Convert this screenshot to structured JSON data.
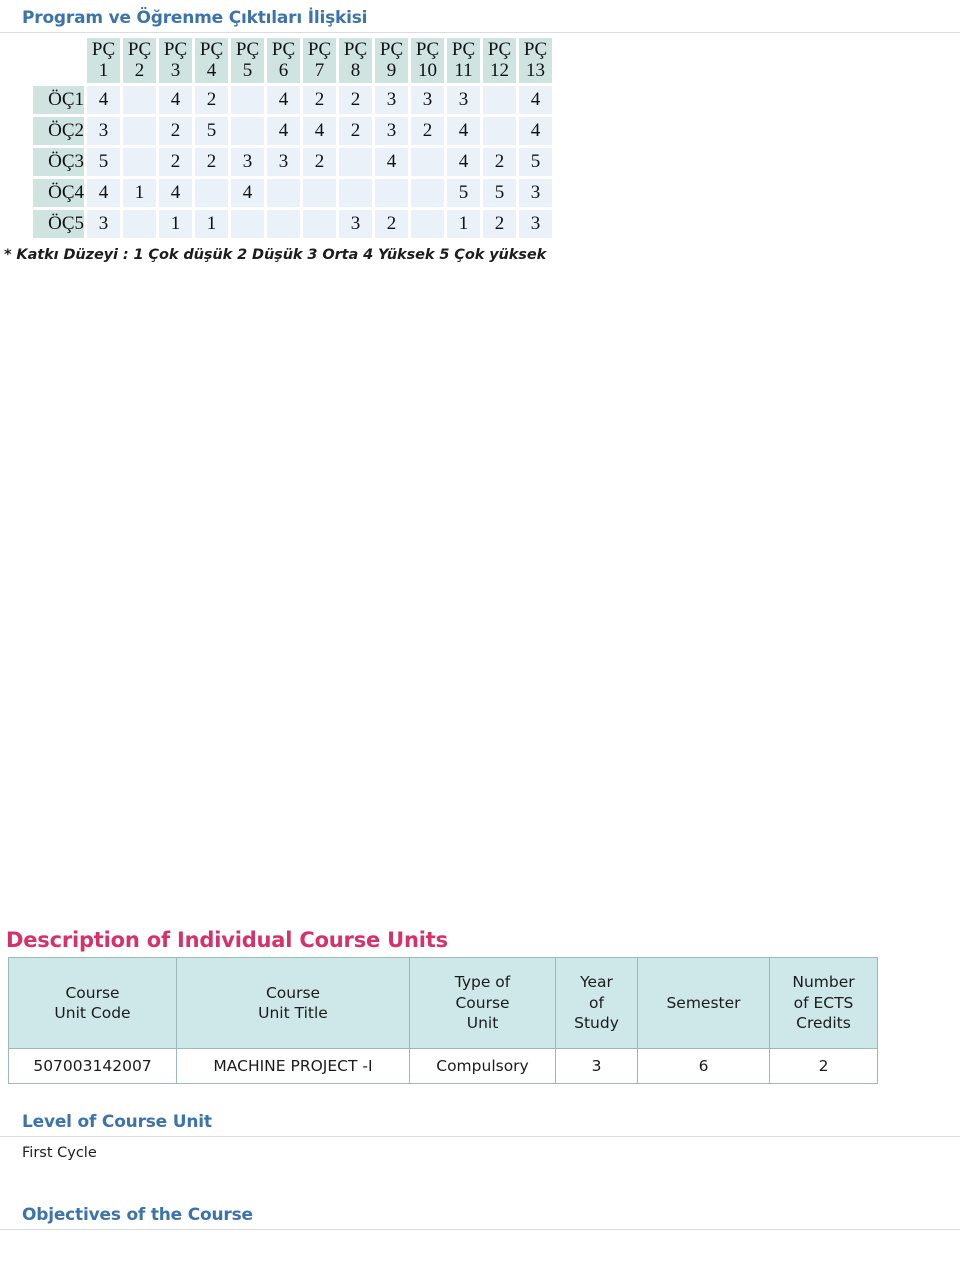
{
  "sections": {
    "relation": {
      "title": "Program ve Öğrenme Çıktıları İlişkisi",
      "note": "* Katkı Düzeyi : 1 Çok düşük 2 Düşük 3 Orta 4 Yüksek 5 Çok yüksek"
    },
    "description": {
      "title": "Description of Individual Course Units"
    },
    "level": {
      "title": "Level of Course Unit",
      "value": "First Cycle"
    },
    "objectives": {
      "title": "Objectives of the Course",
      "value": ""
    }
  },
  "chart_data": {
    "type": "heatmap",
    "title": "Program ve Öğrenme Çıktıları İlişkisi",
    "xlabel": "",
    "ylabel": "",
    "grid": true,
    "legend": "* Katkı Düzeyi : 1 Çok düşük 2 Düşük 3 Orta 4 Yüksek 5 Çok yüksek",
    "corner_label": "",
    "columns": [
      "PÇ 1",
      "PÇ 2",
      "PÇ 3",
      "PÇ 4",
      "PÇ 5",
      "PÇ 6",
      "PÇ 7",
      "PÇ 8",
      "PÇ 9",
      "PÇ 10",
      "PÇ 11",
      "PÇ 12",
      "PÇ 13"
    ],
    "column_lines": [
      [
        "PÇ",
        "1"
      ],
      [
        "PÇ",
        "2"
      ],
      [
        "PÇ",
        "3"
      ],
      [
        "PÇ",
        "4"
      ],
      [
        "PÇ",
        "5"
      ],
      [
        "PÇ",
        "6"
      ],
      [
        "PÇ",
        "7"
      ],
      [
        "PÇ",
        "8"
      ],
      [
        "PÇ",
        "9"
      ],
      [
        "PÇ",
        "10"
      ],
      [
        "PÇ",
        "11"
      ],
      [
        "PÇ",
        "12"
      ],
      [
        "PÇ",
        "13"
      ]
    ],
    "rows": [
      "ÖÇ1",
      "ÖÇ2",
      "ÖÇ3",
      "ÖÇ4",
      "ÖÇ5"
    ],
    "values": [
      [
        "4",
        "",
        "4",
        "2",
        "",
        "4",
        "2",
        "2",
        "3",
        "3",
        "3",
        "",
        "4"
      ],
      [
        "3",
        "",
        "2",
        "5",
        "",
        "4",
        "4",
        "2",
        "3",
        "2",
        "4",
        "",
        "4"
      ],
      [
        "5",
        "",
        "2",
        "2",
        "3",
        "3",
        "2",
        "",
        "4",
        "",
        "4",
        "2",
        "5"
      ],
      [
        "4",
        "1",
        "4",
        "",
        "4",
        "",
        "",
        "",
        "",
        "",
        "5",
        "5",
        "3"
      ],
      [
        "3",
        "",
        "1",
        "1",
        "",
        "",
        "",
        "3",
        "2",
        "",
        "1",
        "2",
        "3"
      ]
    ],
    "scale_legend": [
      {
        "level": "1",
        "label": "Çok düşük"
      },
      {
        "level": "2",
        "label": "Düşük"
      },
      {
        "level": "3",
        "label": "Orta"
      },
      {
        "level": "4",
        "label": "Yüksek"
      },
      {
        "level": "5",
        "label": "Çok yüksek"
      }
    ]
  },
  "course_table": {
    "headers": [
      [
        "Course",
        "Unit Code"
      ],
      [
        "Course",
        "Unit Title"
      ],
      [
        "Type of",
        "Course",
        "Unit"
      ],
      [
        "Year",
        "of",
        "Study"
      ],
      [
        "Semester"
      ],
      [
        "Number",
        "of ECTS",
        "Credits"
      ]
    ],
    "rows": [
      {
        "code": "507003142007",
        "title": "MACHINE PROJECT -I",
        "type": "Compulsory",
        "year": "3",
        "semester": "6",
        "ects": "2"
      }
    ]
  },
  "colors": {
    "heading_blue": "#3d73ad",
    "heading_pink": "#d6326a",
    "matrix_header_bg": "#cfe3e1",
    "matrix_cell_bg": "#eaf1f8",
    "desc_header_bg": "#cee8e9",
    "rule": "#d9dde1"
  }
}
